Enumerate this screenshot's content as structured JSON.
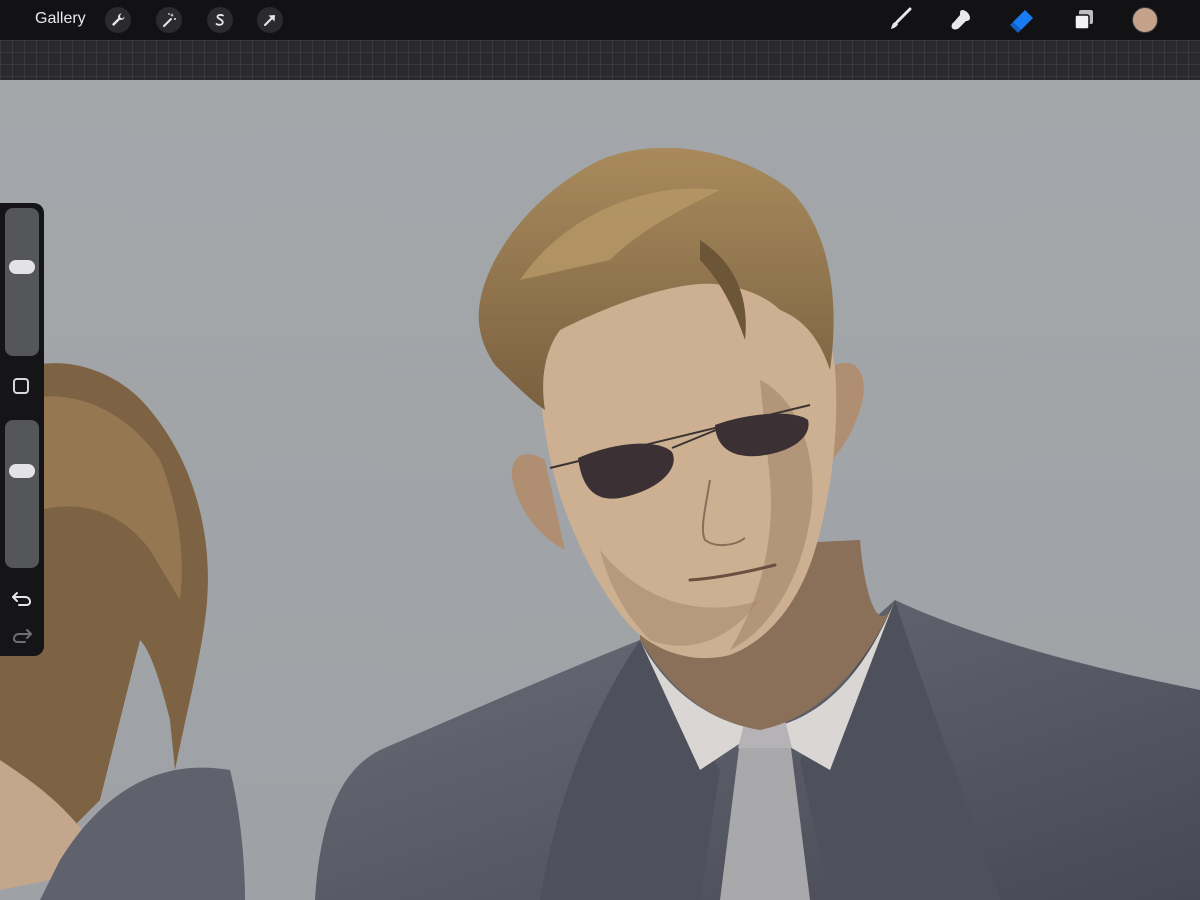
{
  "toolbar": {
    "gallery_label": "Gallery",
    "left_tools": [
      {
        "name": "actions",
        "icon": "wrench-icon"
      },
      {
        "name": "adjustments",
        "icon": "magic-wand-icon"
      },
      {
        "name": "selection",
        "icon": "selection-s-icon"
      },
      {
        "name": "transform",
        "icon": "arrow-cursor-icon"
      }
    ],
    "right_tools": [
      {
        "name": "brush",
        "icon": "brush-icon",
        "active": false
      },
      {
        "name": "smudge",
        "icon": "smudge-icon",
        "active": false
      },
      {
        "name": "eraser",
        "icon": "eraser-icon",
        "active": true
      },
      {
        "name": "layers",
        "icon": "layers-icon",
        "active": false
      }
    ],
    "active_color": "#c4a28a",
    "accent_color": "#1a7cf5"
  },
  "sidebar": {
    "brush_size_level": 0.62,
    "opacity_level": 0.68,
    "modify_icon": "square-icon",
    "undo_icon": "undo-icon",
    "redo_icon": "redo-icon"
  },
  "canvas": {
    "background_color": "#a4a8ab"
  }
}
